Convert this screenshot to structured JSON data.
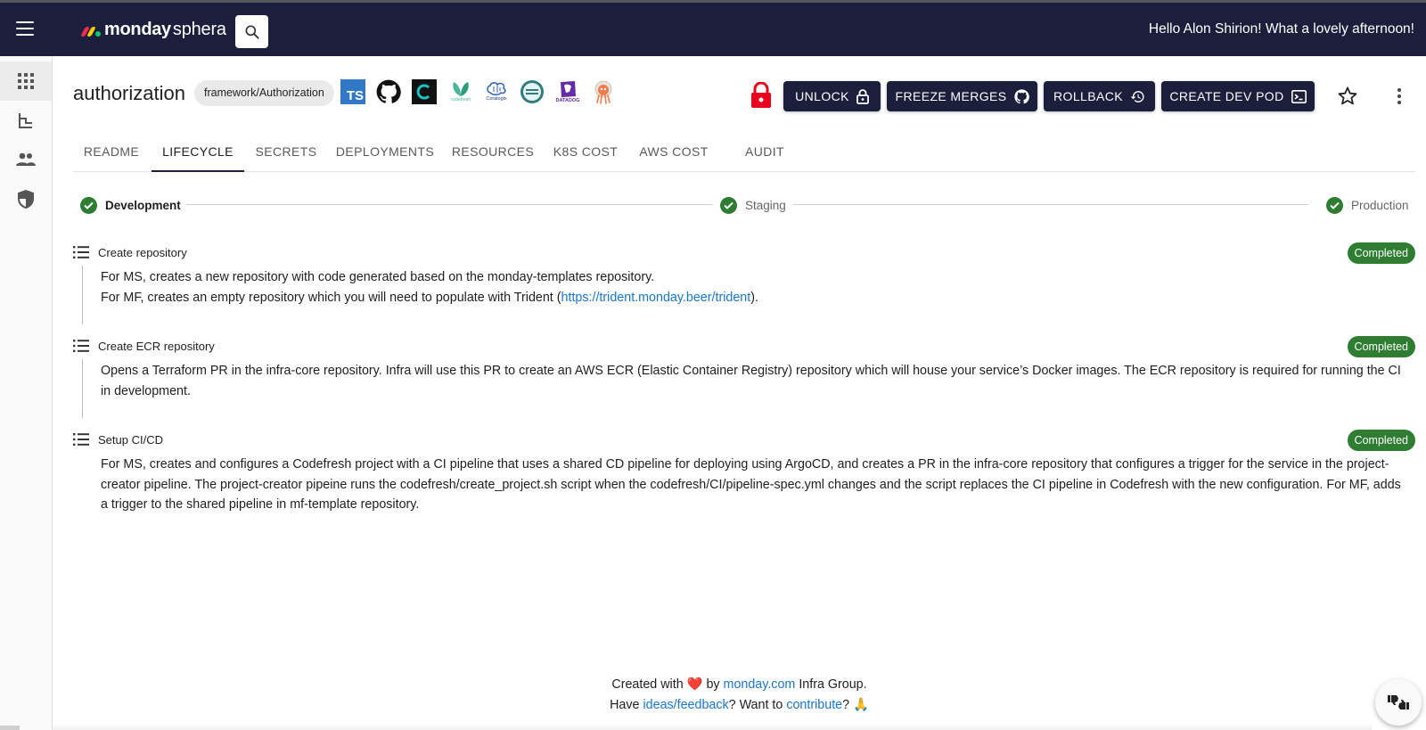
{
  "app": {
    "logo_primary": "monday",
    "logo_secondary": "sphera",
    "greeting": "Hello Alon Shirion! What a lovely afternoon!",
    "logo_colors": [
      "#f62b54",
      "#ffcc00",
      "#00ca72"
    ]
  },
  "rail": {
    "items": [
      "apps-grid-icon",
      "hierarchy-icon",
      "people-icon",
      "shield-icon"
    ]
  },
  "header": {
    "title": "authorization",
    "chip": "framework/Authorization",
    "tools": {
      "ts": "TS",
      "codefresh": "codefresh",
      "coralogix": "Coralogix",
      "datadog": "DATADOG"
    },
    "actions": {
      "unlock": "UNLOCK",
      "freeze": "FREEZE MERGES",
      "rollback": "ROLLBACK",
      "dev_pod": "CREATE DEV POD"
    }
  },
  "tabs": [
    "README",
    "LIFECYCLE",
    "SECRETS",
    "DEPLOYMENTS",
    "RESOURCES",
    "K8S COST",
    "AWS COST",
    "AUDIT"
  ],
  "active_tab": "LIFECYCLE",
  "stepper": {
    "steps": [
      "Development",
      "Staging",
      "Production"
    ]
  },
  "items": [
    {
      "title": "Create repository",
      "status": "Completed",
      "line1": "For MS, creates a new repository with code generated based on the monday-templates repository.",
      "line2_pre": "For MF, creates an empty repository which you will need to populate with Trident (",
      "line2_link": "https://trident.monday.beer/trident",
      "line2_post": ")."
    },
    {
      "title": "Create ECR repository",
      "status": "Completed",
      "line1": "Opens a Terraform PR in the infra-core repository. Infra will use this PR to create an AWS ECR (Elastic Container Registry) repository which will house your service’s Docker images. The ECR repository is required for running the CI in development."
    },
    {
      "title": "Setup CI/CD",
      "status": "Completed",
      "line1": "For MS, creates and configures a Codefresh project with a CI pipeline that uses a shared CD pipeline for deploying using ArgoCD, and creates a PR in the infra-core repository that configures a trigger for the service in the project-creator pipeline. The project-creator pipeine runs the codefresh/create_project.sh script when the codefresh/CI/pipeline-spec.yml changes and the script replaces the CI pipeline in Codefresh with the new configuration. For MF, adds a trigger to the shared pipeline in mf-template repository."
    }
  ],
  "footer": {
    "created_pre": "Created with",
    "heart": "❤️",
    "by": "by",
    "company_link": "monday.com",
    "group": "Infra Group.",
    "have": "Have",
    "feedback_link": "ideas/feedback",
    "want": "? Want to",
    "contribute_link": "contribute",
    "end": "?",
    "pray": "🙏"
  },
  "colors": {
    "topbar": "#1c1f3b",
    "success": "#2e7d32",
    "link": "#1976d2",
    "lock": "#e8001c"
  }
}
